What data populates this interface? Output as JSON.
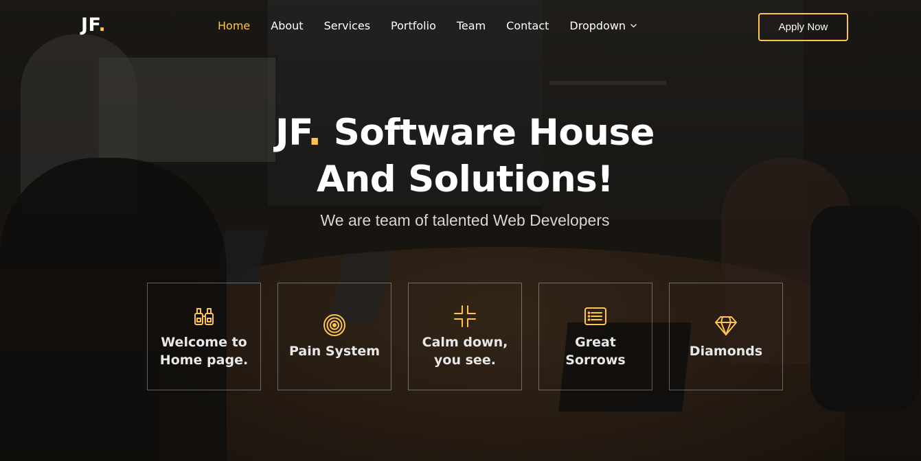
{
  "brand": {
    "logo_text": "JF",
    "logo_dot": ".",
    "accent": "#ffc451"
  },
  "nav": {
    "items": [
      {
        "label": "Home",
        "active": true
      },
      {
        "label": "About"
      },
      {
        "label": "Services"
      },
      {
        "label": "Portfolio"
      },
      {
        "label": "Team"
      },
      {
        "label": "Contact"
      },
      {
        "label": "Dropdown",
        "icon": "chevron-down-icon"
      }
    ]
  },
  "header": {
    "cta_label": "Apply Now"
  },
  "hero": {
    "title_brand": "JF",
    "title_dot": ".",
    "title_line1_rest": " Software House",
    "title_line2": "And Solutions!",
    "subtitle": "We are team of talented Web Developers"
  },
  "features": [
    {
      "icon": "binoculars-icon",
      "label": "Welcome to Home page."
    },
    {
      "icon": "target-icon",
      "label": "Pain System"
    },
    {
      "icon": "collapse-arrows-icon",
      "label": "Calm down, you see."
    },
    {
      "icon": "list-card-icon",
      "label": "Great Sorrows"
    },
    {
      "icon": "diamond-icon",
      "label": "Diamonds"
    }
  ]
}
